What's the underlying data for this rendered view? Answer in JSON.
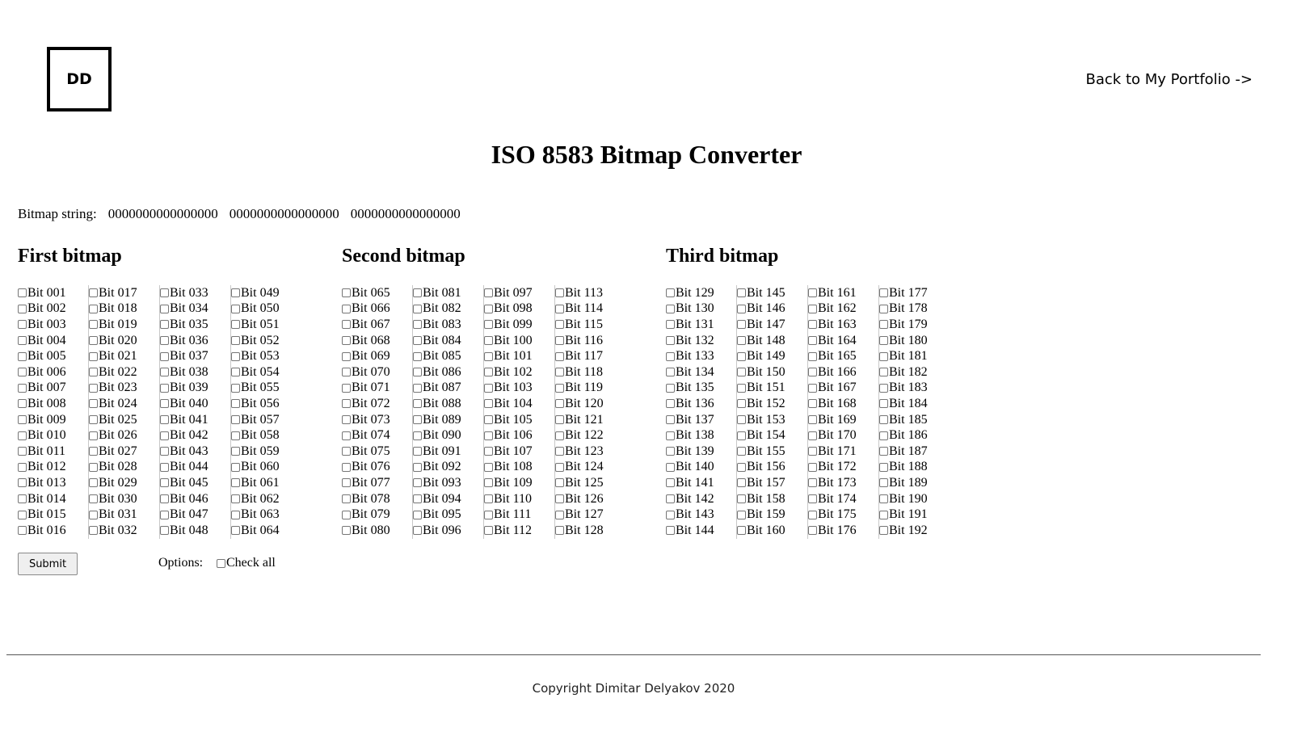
{
  "header": {
    "logo_text": "DD",
    "back_link": "Back to My Portfolio ->"
  },
  "page_title": "ISO 8583 Bitmap Converter",
  "bitmap_string": {
    "label": "Bitmap string:",
    "values": [
      "0000000000000000",
      "0000000000000000",
      "0000000000000000"
    ]
  },
  "bitmaps": [
    {
      "title": "First bitmap",
      "columns": [
        [
          "Bit 001",
          "Bit 002",
          "Bit 003",
          "Bit 004",
          "Bit 005",
          "Bit 006",
          "Bit 007",
          "Bit 008",
          "Bit 009",
          "Bit 010",
          "Bit 011",
          "Bit 012",
          "Bit 013",
          "Bit 014",
          "Bit 015",
          "Bit 016"
        ],
        [
          "Bit 017",
          "Bit 018",
          "Bit 019",
          "Bit 020",
          "Bit 021",
          "Bit 022",
          "Bit 023",
          "Bit 024",
          "Bit 025",
          "Bit 026",
          "Bit 027",
          "Bit 028",
          "Bit 029",
          "Bit 030",
          "Bit 031",
          "Bit 032"
        ],
        [
          "Bit 033",
          "Bit 034",
          "Bit 035",
          "Bit 036",
          "Bit 037",
          "Bit 038",
          "Bit 039",
          "Bit 040",
          "Bit 041",
          "Bit 042",
          "Bit 043",
          "Bit 044",
          "Bit 045",
          "Bit 046",
          "Bit 047",
          "Bit 048"
        ],
        [
          "Bit 049",
          "Bit 050",
          "Bit 051",
          "Bit 052",
          "Bit 053",
          "Bit 054",
          "Bit 055",
          "Bit 056",
          "Bit 057",
          "Bit 058",
          "Bit 059",
          "Bit 060",
          "Bit 061",
          "Bit 062",
          "Bit 063",
          "Bit 064"
        ]
      ]
    },
    {
      "title": "Second bitmap",
      "columns": [
        [
          "Bit 065",
          "Bit 066",
          "Bit 067",
          "Bit 068",
          "Bit 069",
          "Bit 070",
          "Bit 071",
          "Bit 072",
          "Bit 073",
          "Bit 074",
          "Bit 075",
          "Bit 076",
          "Bit 077",
          "Bit 078",
          "Bit 079",
          "Bit 080"
        ],
        [
          "Bit 081",
          "Bit 082",
          "Bit 083",
          "Bit 084",
          "Bit 085",
          "Bit 086",
          "Bit 087",
          "Bit 088",
          "Bit 089",
          "Bit 090",
          "Bit 091",
          "Bit 092",
          "Bit 093",
          "Bit 094",
          "Bit 095",
          "Bit 096"
        ],
        [
          "Bit 097",
          "Bit 098",
          "Bit 099",
          "Bit 100",
          "Bit 101",
          "Bit 102",
          "Bit 103",
          "Bit 104",
          "Bit 105",
          "Bit 106",
          "Bit 107",
          "Bit 108",
          "Bit 109",
          "Bit 110",
          "Bit 111",
          "Bit 112"
        ],
        [
          "Bit 113",
          "Bit 114",
          "Bit 115",
          "Bit 116",
          "Bit 117",
          "Bit 118",
          "Bit 119",
          "Bit 120",
          "Bit 121",
          "Bit 122",
          "Bit 123",
          "Bit 124",
          "Bit 125",
          "Bit 126",
          "Bit 127",
          "Bit 128"
        ]
      ]
    },
    {
      "title": "Third bitmap",
      "columns": [
        [
          "Bit 129",
          "Bit 130",
          "Bit 131",
          "Bit 132",
          "Bit 133",
          "Bit 134",
          "Bit 135",
          "Bit 136",
          "Bit 137",
          "Bit 138",
          "Bit 139",
          "Bit 140",
          "Bit 141",
          "Bit 142",
          "Bit 143",
          "Bit 144"
        ],
        [
          "Bit 145",
          "Bit 146",
          "Bit 147",
          "Bit 148",
          "Bit 149",
          "Bit 150",
          "Bit 151",
          "Bit 152",
          "Bit 153",
          "Bit 154",
          "Bit 155",
          "Bit 156",
          "Bit 157",
          "Bit 158",
          "Bit 159",
          "Bit 160"
        ],
        [
          "Bit 161",
          "Bit 162",
          "Bit 163",
          "Bit 164",
          "Bit 165",
          "Bit 166",
          "Bit 167",
          "Bit 168",
          "Bit 169",
          "Bit 170",
          "Bit 171",
          "Bit 172",
          "Bit 173",
          "Bit 174",
          "Bit 175",
          "Bit 176"
        ],
        [
          "Bit 177",
          "Bit 178",
          "Bit 179",
          "Bit 180",
          "Bit 181",
          "Bit 182",
          "Bit 183",
          "Bit 184",
          "Bit 185",
          "Bit 186",
          "Bit 187",
          "Bit 188",
          "Bit 189",
          "Bit 190",
          "Bit 191",
          "Bit 192"
        ]
      ]
    }
  ],
  "controls": {
    "submit_label": "Submit",
    "options_label": "Options:",
    "check_all_label": "Check all"
  },
  "footer": {
    "copyright": "Copyright Dimitar Delyakov 2020"
  }
}
